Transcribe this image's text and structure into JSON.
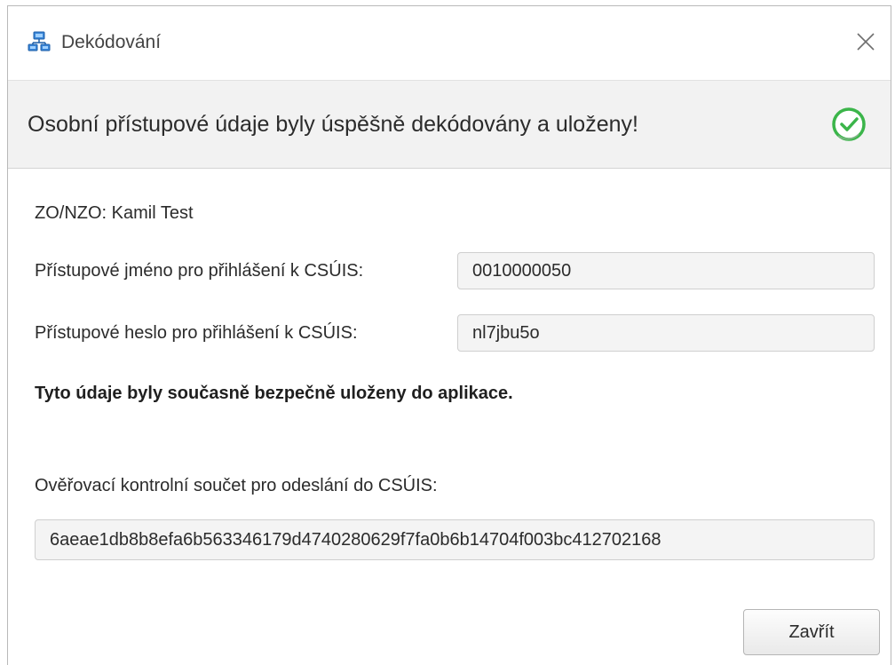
{
  "window": {
    "title": "Dekódování",
    "app_icon": "network-computers-icon",
    "close_icon": "close-icon"
  },
  "header": {
    "message": "Osobní přístupové údaje byly úspěšně dekódovány a uloženy!",
    "status_icon": "success-check-icon",
    "accent_color": "#3bb54a"
  },
  "content": {
    "zo_label": "ZO/NZO: Kamil Test",
    "username_label": "Přístupové jméno pro přihlášení k CSÚIS:",
    "username_value": "0010000050",
    "password_label": "Přístupové heslo pro přihlášení k CSÚIS:",
    "password_value": "nl7jbu5o",
    "saved_note": "Tyto údaje byly současně bezpečně uloženy do aplikace.",
    "checksum_label": "Ověřovací kontrolní součet pro odeslání do CSÚIS:",
    "checksum_value": "6aeae1db8b8efa6b563346179d4740280629f7fa0b6b14704f003bc412702168"
  },
  "footer": {
    "close_label": "Zavřít"
  }
}
